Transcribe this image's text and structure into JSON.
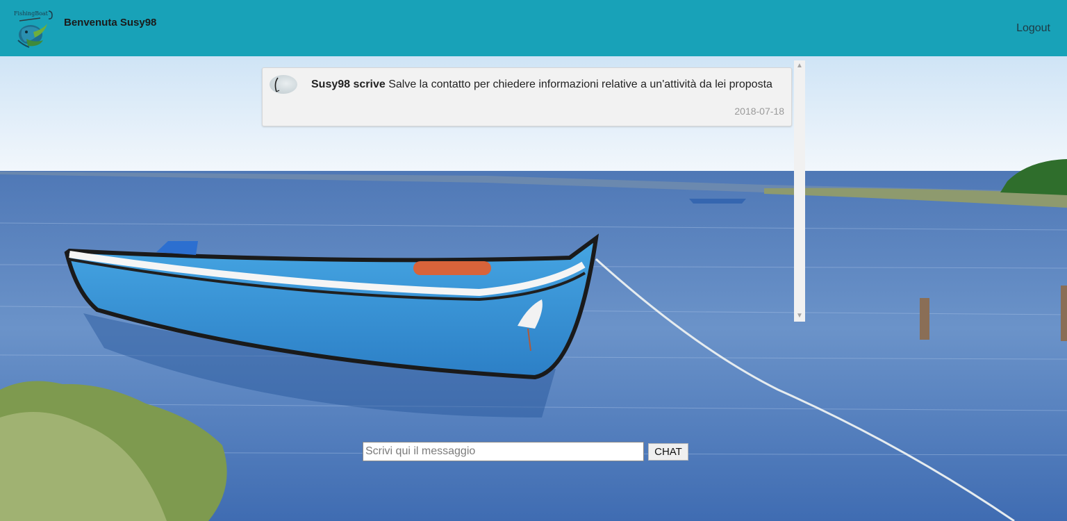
{
  "header": {
    "welcome": "Benvenuta Susy98",
    "logout_label": "Logout",
    "logo_text": "FishingBoat",
    "background_color": "#18a2b8"
  },
  "chat": {
    "messages": [
      {
        "author_label": "Susy98 scrive",
        "text": "Salve la contatto per chiedere informazioni relative a un'attività da lei proposta",
        "date": "2018-07-18"
      }
    ]
  },
  "composer": {
    "placeholder": "Scrivi qui il messaggio",
    "value": "",
    "send_label": "CHAT"
  },
  "icons": {
    "logo": "fish-logo-icon",
    "scroll_up": "scroll-up-arrow-icon",
    "scroll_down": "scroll-down-arrow-icon"
  }
}
